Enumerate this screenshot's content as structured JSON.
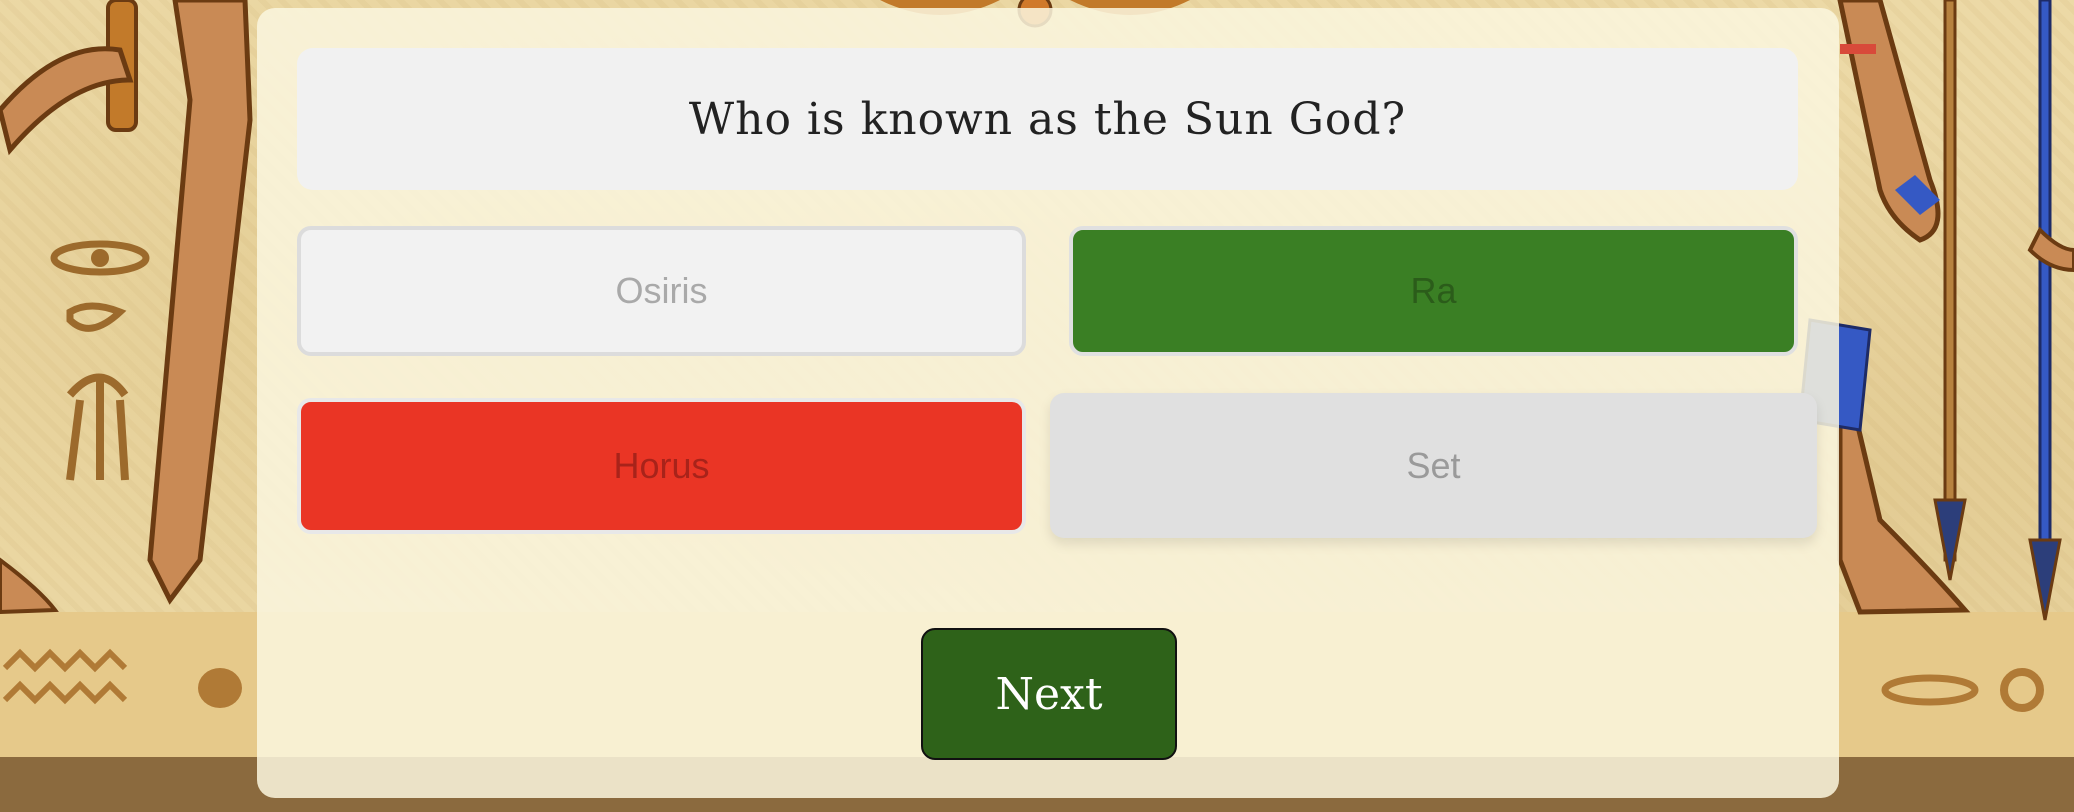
{
  "quiz": {
    "question": "Who is known as the Sun God?",
    "answers": [
      {
        "label": "Osiris",
        "state": "neutral"
      },
      {
        "label": "Ra",
        "state": "correct"
      },
      {
        "label": "Horus",
        "state": "incorrect"
      },
      {
        "label": "Set",
        "state": "neutral"
      }
    ],
    "next_label": "Next"
  },
  "colors": {
    "correct": "#3a7f24",
    "incorrect": "#ea3525",
    "next_button": "#2e6219",
    "panel": "#faf6de",
    "background": "#ecd9a6"
  }
}
